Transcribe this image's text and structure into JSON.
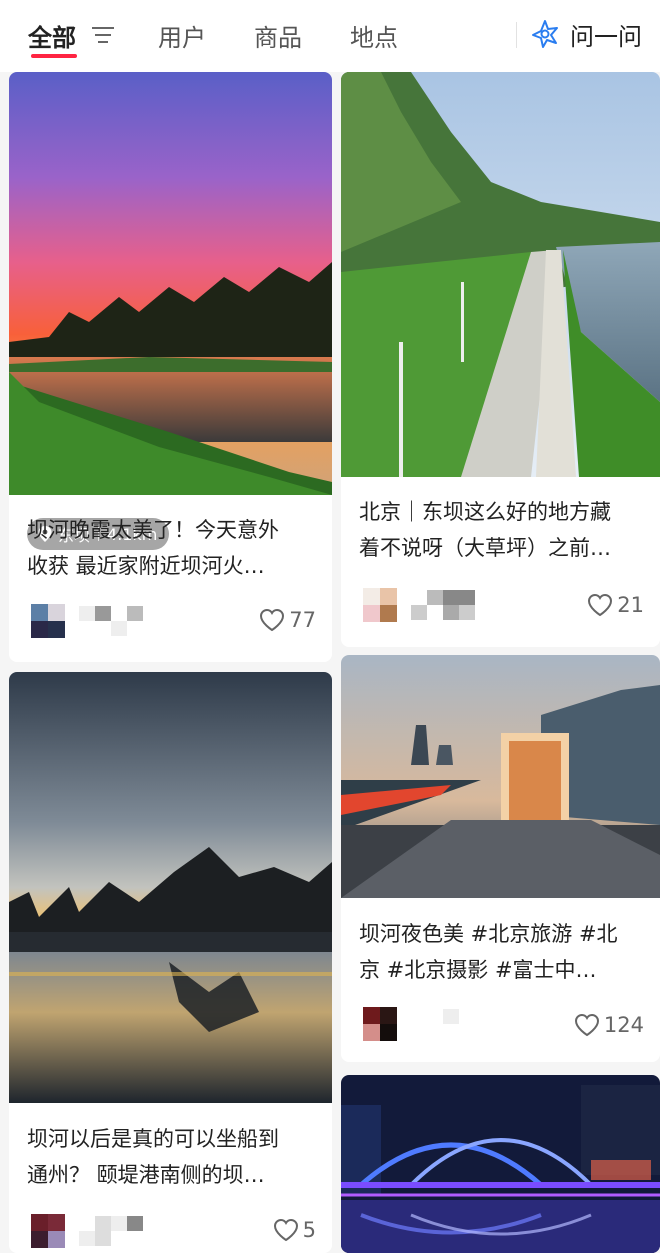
{
  "tabs": {
    "all": "全部",
    "users": "用户",
    "products": "商品",
    "places": "地点"
  },
  "ask_label": "问一问",
  "accent_color": "#ff2442",
  "cards": [
    {
      "title_line1": "坝河晚霞太美了！今天意外",
      "title_line2": "收获 最近家附近坝河火…",
      "location": "东坝",
      "distance": "4.1km",
      "likes": "77",
      "image_icon": "sunset-river-photo"
    },
    {
      "title_line1": "北京｜东坝这么好的地方藏",
      "title_line2": "着不说呀（大草坪）之前…",
      "likes": "21",
      "image_icon": "riverside-path-photo"
    },
    {
      "title_line1": "坝河以后是真的可以坐船到",
      "title_line2": "通州？ 颐堤港南侧的坝…",
      "likes": "5",
      "image_icon": "river-dusk-city-photo"
    },
    {
      "title_line1": "坝河夜色美 #北京旅游 #北",
      "title_line2": "京 #北京摄影 #富士中…",
      "likes": "124",
      "image_icon": "night-promenade-photo"
    },
    {
      "image_icon": "neon-bridge-photo"
    }
  ]
}
